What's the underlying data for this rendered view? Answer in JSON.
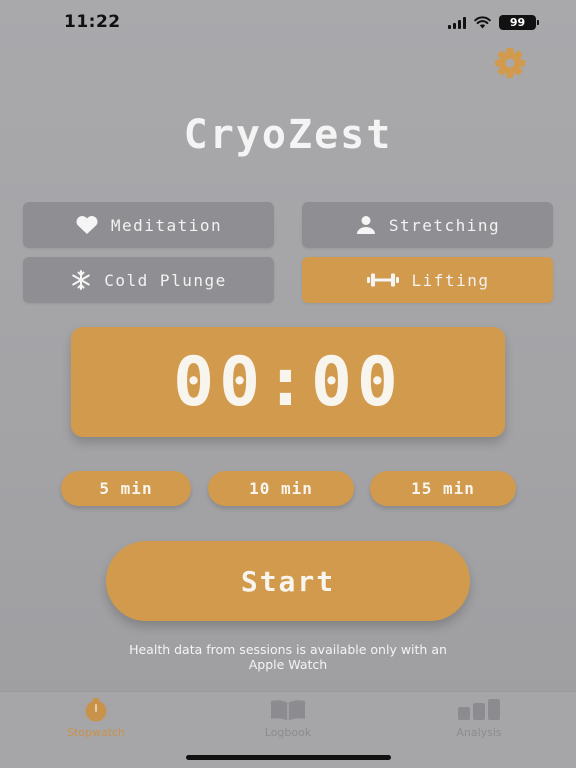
{
  "status_bar": {
    "time": "11:22",
    "battery": "99",
    "icons": [
      "signal-icon",
      "wifi-icon",
      "battery-icon"
    ]
  },
  "header": {
    "title": "CryoZest",
    "settings_icon": "gear-icon"
  },
  "activities": [
    {
      "label": "Meditation",
      "icon": "heart-icon",
      "selected": false
    },
    {
      "label": "Stretching",
      "icon": "person-icon",
      "selected": false
    },
    {
      "label": "Cold Plunge",
      "icon": "snowflake-icon",
      "selected": false
    },
    {
      "label": "Lifting",
      "icon": "dumbbell-icon",
      "selected": true
    }
  ],
  "timer": {
    "display": "00:00"
  },
  "presets": [
    {
      "label": "5 min"
    },
    {
      "label": "10 min"
    },
    {
      "label": "15 min"
    }
  ],
  "start_button": {
    "label": "Start"
  },
  "health_note": {
    "line1": "Health data from sessions is available only with an",
    "line2": "Apple Watch"
  },
  "tab_bar": {
    "tabs": [
      {
        "label": "Stopwatch",
        "icon": "stopwatch-icon",
        "active": true
      },
      {
        "label": "Logbook",
        "icon": "book-icon",
        "active": false
      },
      {
        "label": "Analysis",
        "icon": "bar-chart-icon",
        "active": false
      }
    ]
  },
  "colors": {
    "accent": "#d19a4d",
    "button_gray": "#8f8f93",
    "background": "#a6a6a9",
    "text_light": "#f4f4f4"
  }
}
